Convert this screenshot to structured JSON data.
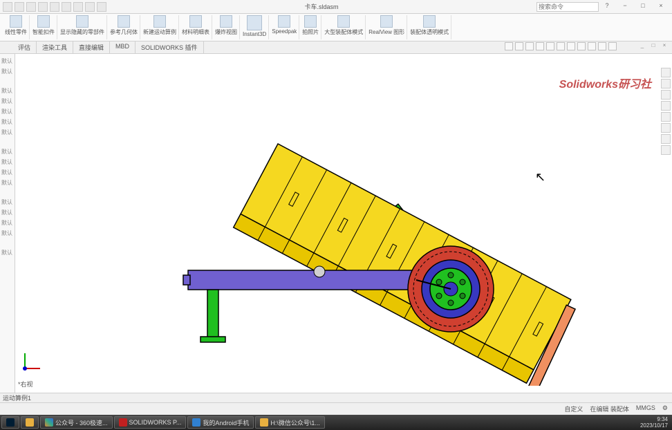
{
  "title": "卡车.sldasm",
  "search_placeholder": "搜索命令",
  "ribbon": [
    {
      "label": "线性零件"
    },
    {
      "label": "智能扣件"
    },
    {
      "label": "显示隐藏的零部件"
    },
    {
      "label": "参考几何体"
    },
    {
      "label": "新建运动算例"
    },
    {
      "label": "材料明细表"
    },
    {
      "label": "爆炸视图"
    },
    {
      "label": "Instant3D"
    },
    {
      "label": "Speedpak"
    },
    {
      "label": "拍照片"
    },
    {
      "label": "大型装配体模式"
    },
    {
      "label": "RealView 图形"
    },
    {
      "label": "装配体透明模式"
    }
  ],
  "tabs": [
    {
      "label": "评估"
    },
    {
      "label": "渲染工具"
    },
    {
      "label": "直接编辑"
    },
    {
      "label": "MBD"
    },
    {
      "label": "SOLIDWORKS 插件"
    }
  ],
  "tree_items": [
    "默认",
    "默认",
    "",
    "默认",
    "默认",
    "默认",
    "默认",
    "默认",
    "默认",
    "默认",
    "默认",
    "默认",
    "默认",
    "默认",
    "默认",
    "默认",
    "默认"
  ],
  "view_name": "*右视",
  "motion_study": "运动算例1",
  "watermark": "Solidworks研习社",
  "status": {
    "left": "",
    "def": "自定义",
    "edit": "在编辑 装配体",
    "units": "MMGS"
  },
  "taskbar": [
    {
      "label": ""
    },
    {
      "label": ""
    },
    {
      "label": ""
    },
    {
      "label": "公众号 - 360极速..."
    },
    {
      "label": "SOLIDWORKS P..."
    },
    {
      "label": "我的Android手机"
    },
    {
      "label": "H:\\微信公众号\\1..."
    }
  ],
  "clock": {
    "time": "9:34",
    "date": "2023/10/17"
  }
}
